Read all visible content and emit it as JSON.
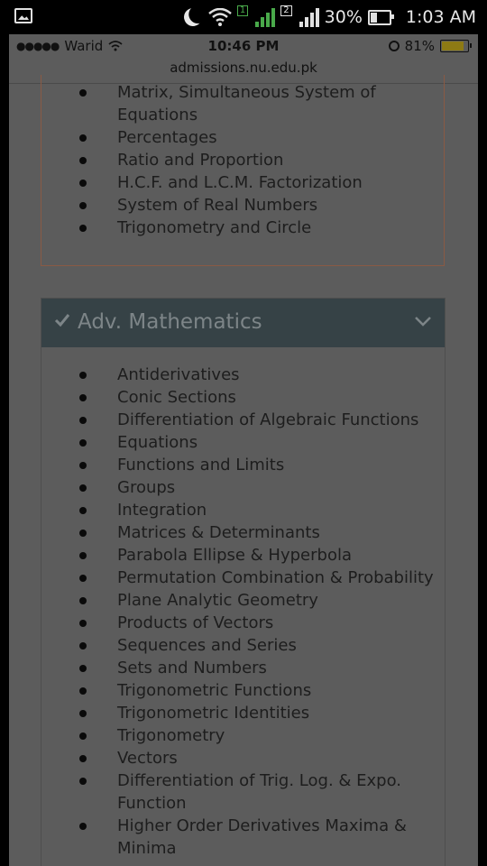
{
  "android_status": {
    "sim1": "1",
    "sim2": "2",
    "battery": "30%",
    "time": "1:03 AM"
  },
  "ios_status": {
    "carrier": "Warid",
    "time": "10:46 PM",
    "battery": "81%"
  },
  "browser": {
    "url": "admissions.nu.edu.pk"
  },
  "section_prev": {
    "items": [
      "Matrix, Simultaneous System of Equations",
      "Percentages",
      "Ratio and Proportion",
      "H.C.F. and L.C.M. Factorization",
      "System of Real Numbers",
      "Trigonometry and Circle"
    ]
  },
  "section_adv": {
    "title": "Adv. Mathematics",
    "items": [
      "Antiderivatives",
      "Conic Sections",
      "Differentiation of Algebraic Functions",
      "Equations",
      "Functions and Limits",
      "Groups",
      "Integration",
      "Matrices & Determinants",
      "Parabola Ellipse & Hyperbola",
      "Permutation Combination & Probability",
      "Plane Analytic Geometry",
      "Products of Vectors",
      "Sequences and Series",
      "Sets and Numbers",
      "Trigonometric Functions",
      "Trigonometric Identities",
      "Trigonometry",
      "Vectors",
      "Differentiation of Trig. Log. & Expo. Function",
      "Higher Order Derivatives Maxima & Minima"
    ]
  },
  "colors": {
    "header_bg": "#364246",
    "header_text": "#7d8588",
    "panel1_border": "#8a5a44",
    "page_bg": "#5c5c5c"
  }
}
